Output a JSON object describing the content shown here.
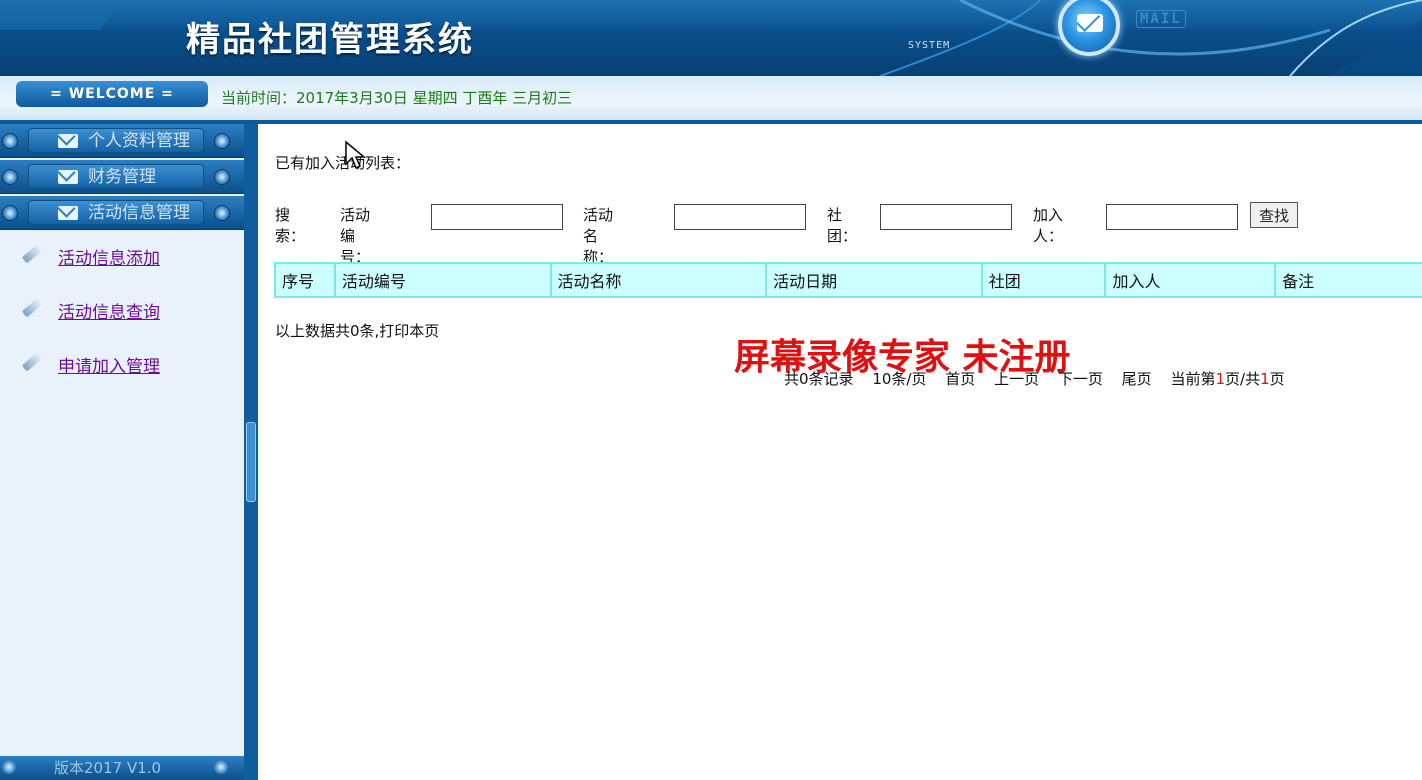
{
  "banner": {
    "title": "精品社团管理系统",
    "system_label": "SYSTEM",
    "mail_label": "MAIL"
  },
  "welcome_bar": {
    "welcome_label": "= WELCOME =",
    "current_time": "当前时间：2017年3月30日 星期四 丁酉年 三月初三"
  },
  "sidebar": {
    "menus": [
      {
        "label": "个人资料管理",
        "icon": "envelope-icon"
      },
      {
        "label": "财务管理",
        "icon": "envelope-icon"
      },
      {
        "label": "活动信息管理",
        "icon": "envelope-icon"
      }
    ],
    "links": [
      {
        "label": "活动信息添加",
        "icon": "pencil-icon"
      },
      {
        "label": "活动信息查询",
        "icon": "pencil-icon"
      },
      {
        "label": "申请加入管理",
        "icon": "pencil-icon"
      }
    ],
    "footer": "版本2017 V1.0"
  },
  "main": {
    "list_title": "已有加入活动列表：",
    "search": {
      "label": "搜索：",
      "activity_no_label": "活动编号：",
      "activity_no_value": "",
      "activity_name_label": "活动名称：",
      "activity_name_value": "",
      "club_label": "社团：",
      "club_value": "",
      "joiner_label": "加入人：",
      "joiner_value": "",
      "find_button": "查找"
    },
    "table": {
      "columns": [
        "序号",
        "活动编号",
        "活动名称",
        "活动日期",
        "社团",
        "加入人",
        "备注"
      ],
      "rows": []
    },
    "summary": "以上数据共0条,打印本页",
    "watermark": "屏幕录像专家  未注册",
    "pager": {
      "total": "共0条记录",
      "per_page": "10条/页",
      "first": "首页",
      "prev": "上一页",
      "next": "下一页",
      "last": "尾页",
      "current_prefix": "当前第",
      "current_page": "1",
      "mid": "页/共",
      "total_pages": "1",
      "suffix": "页"
    }
  }
}
